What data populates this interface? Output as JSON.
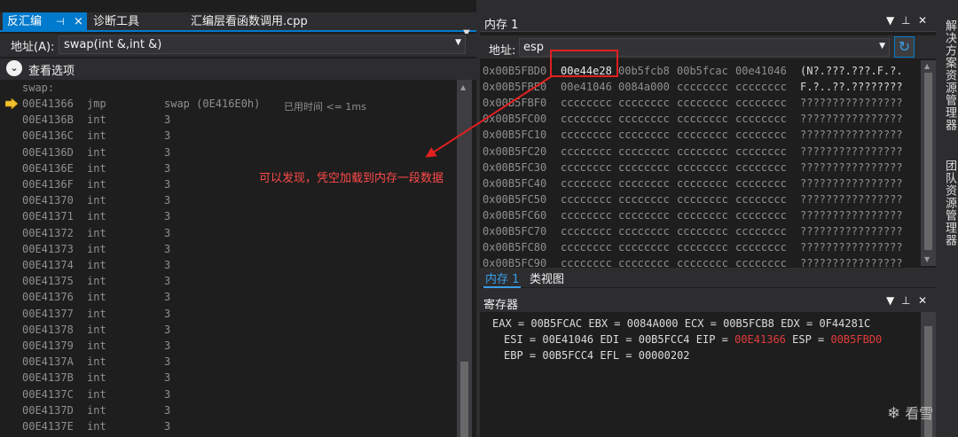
{
  "left_panel": {
    "tabs": [
      {
        "label": "反汇编",
        "active": true
      },
      {
        "label": "诊断工具",
        "active": false
      },
      {
        "label": "汇编层看函数调用.cpp",
        "active": false
      }
    ],
    "pin_icon": "pin-icon",
    "close_icon": "×",
    "menu_icon": "▼",
    "address_label": "地址(A):",
    "address_value": "swap(int &,int &)",
    "view_options_label": "查看选项",
    "code_label": "swap:",
    "rows": [
      {
        "addr": "00E41366",
        "op": "jmp",
        "arg": "swap (0E416E0h)",
        "time": "已用时间 <= 1ms",
        "current": true
      },
      {
        "addr": "00E4136B",
        "op": "int",
        "arg": "3"
      },
      {
        "addr": "00E4136C",
        "op": "int",
        "arg": "3"
      },
      {
        "addr": "00E4136D",
        "op": "int",
        "arg": "3"
      },
      {
        "addr": "00E4136E",
        "op": "int",
        "arg": "3"
      },
      {
        "addr": "00E4136F",
        "op": "int",
        "arg": "3"
      },
      {
        "addr": "00E41370",
        "op": "int",
        "arg": "3"
      },
      {
        "addr": "00E41371",
        "op": "int",
        "arg": "3"
      },
      {
        "addr": "00E41372",
        "op": "int",
        "arg": "3"
      },
      {
        "addr": "00E41373",
        "op": "int",
        "arg": "3"
      },
      {
        "addr": "00E41374",
        "op": "int",
        "arg": "3"
      },
      {
        "addr": "00E41375",
        "op": "int",
        "arg": "3"
      },
      {
        "addr": "00E41376",
        "op": "int",
        "arg": "3"
      },
      {
        "addr": "00E41377",
        "op": "int",
        "arg": "3"
      },
      {
        "addr": "00E41378",
        "op": "int",
        "arg": "3"
      },
      {
        "addr": "00E41379",
        "op": "int",
        "arg": "3"
      },
      {
        "addr": "00E4137A",
        "op": "int",
        "arg": "3"
      },
      {
        "addr": "00E4137B",
        "op": "int",
        "arg": "3"
      },
      {
        "addr": "00E4137C",
        "op": "int",
        "arg": "3"
      },
      {
        "addr": "00E4137D",
        "op": "int",
        "arg": "3"
      },
      {
        "addr": "00E4137E",
        "op": "int",
        "arg": "3"
      }
    ]
  },
  "memory_panel": {
    "title": "内存 1",
    "address_label": "地址:",
    "address_value": "esp",
    "refresh_icon": "refresh-icon",
    "rows": [
      {
        "addr": "0x00B5FBD0",
        "w": [
          "00e44e28",
          "00b5fcb8",
          "00b5fcac",
          "00e41046"
        ],
        "ascii": "(N?.???.???.F.?."
      },
      {
        "addr": "0x00B5FBE0",
        "w": [
          "00e41046",
          "0084a000",
          "cccccccc",
          "cccccccc"
        ],
        "ascii": "F.?..??.????????"
      },
      {
        "addr": "0x00B5FBF0",
        "w": [
          "cccccccc",
          "cccccccc",
          "cccccccc",
          "cccccccc"
        ],
        "ascii": "????????????????"
      },
      {
        "addr": "0x00B5FC00",
        "w": [
          "cccccccc",
          "cccccccc",
          "cccccccc",
          "cccccccc"
        ],
        "ascii": "????????????????"
      },
      {
        "addr": "0x00B5FC10",
        "w": [
          "cccccccc",
          "cccccccc",
          "cccccccc",
          "cccccccc"
        ],
        "ascii": "????????????????"
      },
      {
        "addr": "0x00B5FC20",
        "w": [
          "cccccccc",
          "cccccccc",
          "cccccccc",
          "cccccccc"
        ],
        "ascii": "????????????????"
      },
      {
        "addr": "0x00B5FC30",
        "w": [
          "cccccccc",
          "cccccccc",
          "cccccccc",
          "cccccccc"
        ],
        "ascii": "????????????????"
      },
      {
        "addr": "0x00B5FC40",
        "w": [
          "cccccccc",
          "cccccccc",
          "cccccccc",
          "cccccccc"
        ],
        "ascii": "????????????????"
      },
      {
        "addr": "0x00B5FC50",
        "w": [
          "cccccccc",
          "cccccccc",
          "cccccccc",
          "cccccccc"
        ],
        "ascii": "????????????????"
      },
      {
        "addr": "0x00B5FC60",
        "w": [
          "cccccccc",
          "cccccccc",
          "cccccccc",
          "cccccccc"
        ],
        "ascii": "????????????????"
      },
      {
        "addr": "0x00B5FC70",
        "w": [
          "cccccccc",
          "cccccccc",
          "cccccccc",
          "cccccccc"
        ],
        "ascii": "????????????????"
      },
      {
        "addr": "0x00B5FC80",
        "w": [
          "cccccccc",
          "cccccccc",
          "cccccccc",
          "cccccccc"
        ],
        "ascii": "????????????????"
      },
      {
        "addr": "0x00B5FC90",
        "w": [
          "cccccccc",
          "cccccccc",
          "cccccccc",
          "cccccccc"
        ],
        "ascii": "????????????????"
      }
    ],
    "bottom_tabs": [
      "内存 1",
      "类视图"
    ]
  },
  "registers_panel": {
    "title": "寄存器",
    "line1": "EAX = 00B5FCAC EBX = 0084A000 ECX = 00B5FCB8 EDX = 0F44281C",
    "line2_a": "ESI = 00E41046 EDI = 00B5FCC4 EIP = ",
    "line2_eip": "00E41366",
    "line2_b": " ESP = ",
    "line2_esp": "00B5FBD0",
    "line3": "EBP = 00B5FCC4 EFL = 00000202"
  },
  "sidebar": {
    "solution_explorer": "解决方案资源管理器",
    "team_explorer": "团队资源管理器"
  },
  "annotation": {
    "text": "可以发现，凭空加载到内存一段数据"
  },
  "watermark": {
    "text": "看雪",
    "icon": "snowflake-icon"
  },
  "colors": {
    "accent": "#007acc",
    "highlight": "#e23b3b",
    "background": "#1e1e1e"
  }
}
